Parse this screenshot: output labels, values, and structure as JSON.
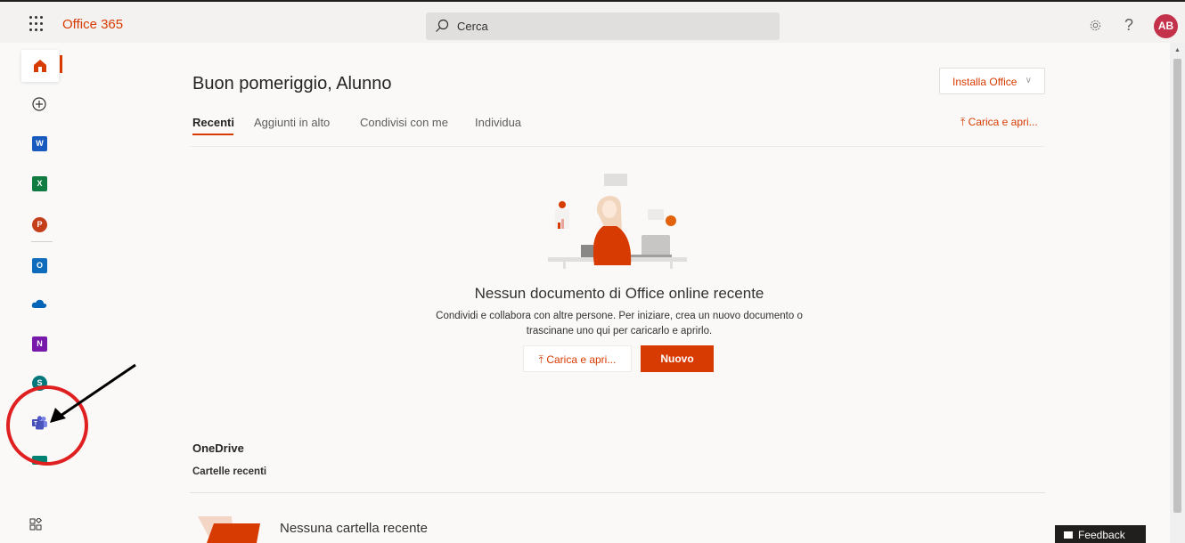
{
  "topbar": {
    "app_launcher_icon": "waffle-icon",
    "brand": "Office 365",
    "search_placeholder": "Cerca",
    "settings_icon": "gear-icon",
    "help_label": "?",
    "avatar_initials": "AB"
  },
  "rail": {
    "items": [
      {
        "name": "Home",
        "icon": "home-icon",
        "active": true
      },
      {
        "name": "Crea",
        "icon": "plus-circle-icon"
      },
      {
        "name": "Word",
        "icon": "word-icon",
        "letter": "W",
        "color": "#185abd"
      },
      {
        "name": "Excel",
        "icon": "excel-icon",
        "letter": "X",
        "color": "#107c41"
      },
      {
        "name": "PowerPoint",
        "icon": "powerpoint-icon",
        "letter": "P",
        "color": "#c43e1c"
      },
      {
        "name": "Outlook",
        "icon": "outlook-icon",
        "letter": "O",
        "color": "#0f6cbd"
      },
      {
        "name": "OneDrive",
        "icon": "onedrive-icon",
        "color": "#0364b8"
      },
      {
        "name": "OneNote",
        "icon": "onenote-icon",
        "letter": "N",
        "color": "#7719aa"
      },
      {
        "name": "SharePoint",
        "icon": "sharepoint-icon",
        "letter": "S",
        "color": "#03787c"
      },
      {
        "name": "Teams",
        "icon": "teams-icon",
        "color": "#4b53bc"
      },
      {
        "name": "Sway",
        "icon": "sway-icon",
        "color": "#008272"
      },
      {
        "name": "Tutte le app",
        "icon": "all-apps-icon"
      }
    ]
  },
  "main": {
    "greeting": "Buon pomeriggio, Alunno",
    "install_label": "Installa Office",
    "tabs": [
      {
        "label": "Recenti",
        "active": true
      },
      {
        "label": "Aggiunti in alto"
      },
      {
        "label": "Condivisi con me"
      },
      {
        "label": "Individua"
      }
    ],
    "upload_link": "Carica e apri...",
    "empty_title": "Nessun documento di Office online recente",
    "empty_desc": "Condividi e collabora con altre persone. Per iniziare, crea un nuovo documento o trascinane uno qui per caricarlo e aprirlo.",
    "btn_upload": "Carica e apri...",
    "btn_new": "Nuovo",
    "onedrive_title": "OneDrive",
    "recent_folders_title": "Cartelle recenti",
    "no_folder": "Nessuna cartella recente"
  },
  "feedback_label": "Feedback",
  "colors": {
    "accent": "#d83b01",
    "annotation": "#e02020"
  }
}
